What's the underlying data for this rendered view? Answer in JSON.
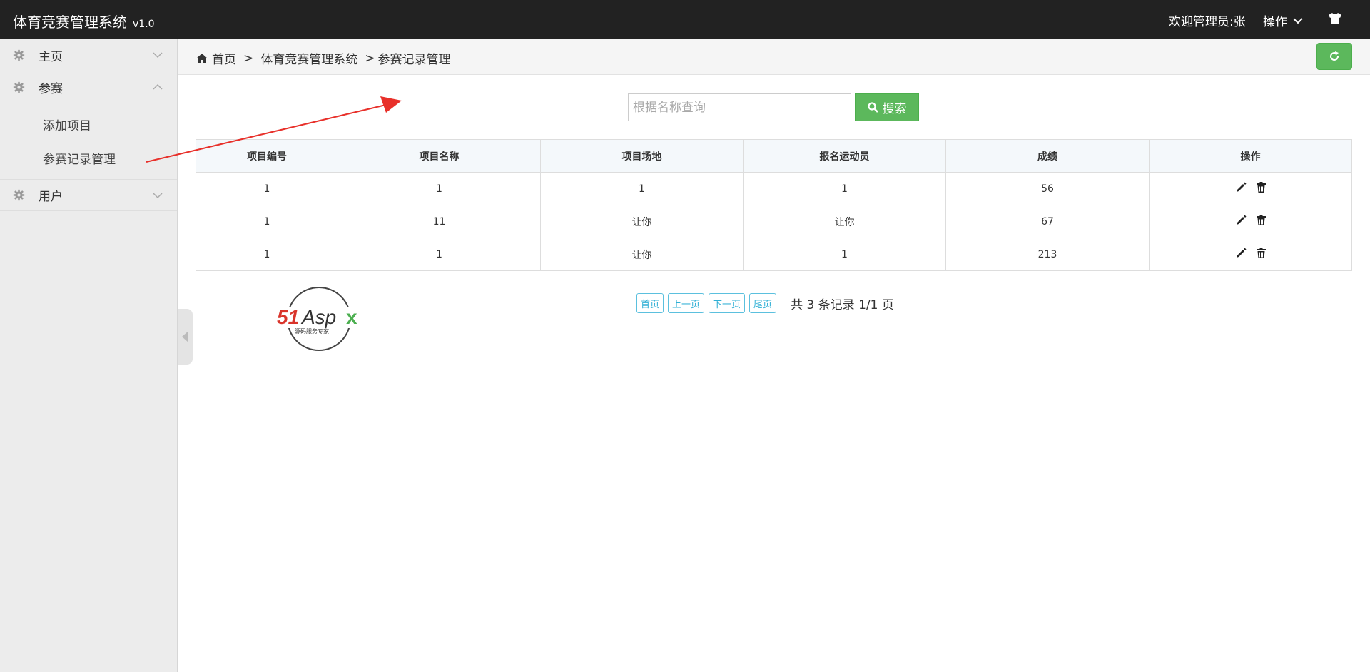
{
  "header": {
    "title": "体育竞赛管理系统",
    "version": "v1.0",
    "welcome": "欢迎管理员:张",
    "ops_label": "操作"
  },
  "sidebar": {
    "items": [
      {
        "label": "主页",
        "expanded": false
      },
      {
        "label": "参赛",
        "expanded": true,
        "children": [
          {
            "label": "添加项目"
          },
          {
            "label": "参赛记录管理"
          }
        ]
      },
      {
        "label": "用户",
        "expanded": false
      }
    ]
  },
  "breadcrumb": {
    "home": "首页",
    "level1": "体育竞赛管理系统",
    "level2": "参赛记录管理",
    "separator": ">"
  },
  "search": {
    "placeholder": "根据名称查询",
    "button_label": "搜索"
  },
  "table": {
    "headers": [
      "项目编号",
      "项目名称",
      "项目场地",
      "报名运动员",
      "成绩",
      "操作"
    ],
    "rows": [
      [
        "1",
        "1",
        "1",
        "1",
        "56"
      ],
      [
        "1",
        "11",
        "让你",
        "让你",
        "67"
      ],
      [
        "1",
        "1",
        "让你",
        "1",
        "213"
      ]
    ]
  },
  "pagination": {
    "first": "首页",
    "prev": "上一页",
    "next": "下一页",
    "last": "尾页",
    "info": "共 3 条记录 1/1 页"
  },
  "logo": {
    "text": "51Aspx",
    "tagline": "源码服务专家"
  },
  "colors": {
    "topbar": "#222222",
    "sidebar": "#ececec",
    "success": "#5cb85c",
    "pager_border": "#5bc0de",
    "arrow": "#e8302a"
  },
  "icons": [
    "gear-icon",
    "chevron-down-icon",
    "chevron-up-icon",
    "home-icon",
    "refresh-icon",
    "search-icon",
    "pencil-icon",
    "trash-icon",
    "shirt-icon"
  ]
}
